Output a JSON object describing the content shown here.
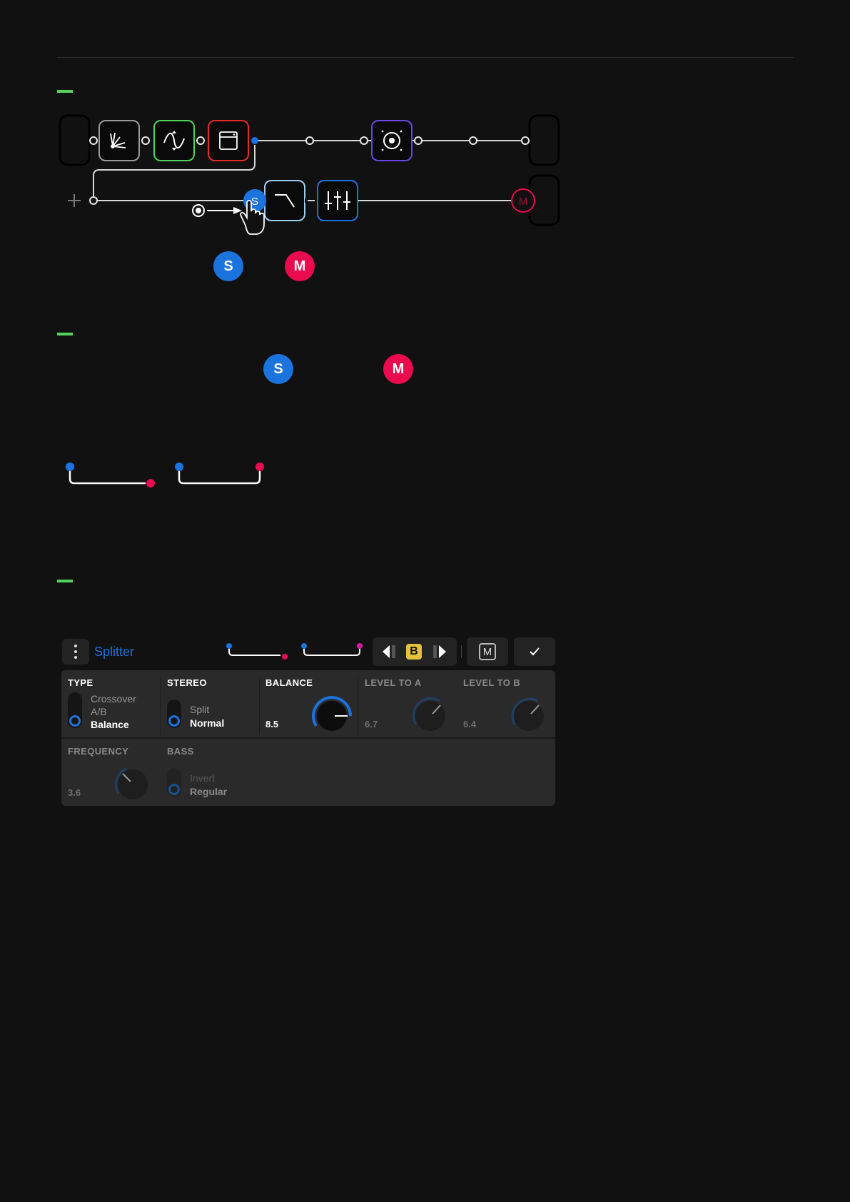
{
  "diagram": {
    "mixer_label": "M",
    "splitter_label": "S"
  },
  "section2": {
    "splitter_label": "S",
    "mixer_label": "M"
  },
  "legend_circles": {
    "splitter_label": "S",
    "mixer_label": "M"
  },
  "editor": {
    "title": "Splitter",
    "ab_label": "B",
    "mixer_button_label": "M",
    "params": {
      "type": {
        "label": "TYPE",
        "options": [
          "Crossover",
          "A/B",
          "Balance"
        ],
        "selected": "Balance"
      },
      "stereo": {
        "label": "STEREO",
        "options": [
          "Split",
          "Normal"
        ],
        "selected": "Normal"
      },
      "balance": {
        "label": "BALANCE",
        "value": "8.5"
      },
      "level_a": {
        "label": "LEVEL TO A",
        "value": "6.7"
      },
      "level_b": {
        "label": "LEVEL TO B",
        "value": "6.4"
      },
      "frequency": {
        "label": "FREQUENCY",
        "value": "3.6"
      },
      "bass": {
        "label": "BASS",
        "options": [
          "Invert",
          "Regular"
        ],
        "selected": "Regular"
      }
    }
  },
  "colors": {
    "background": "#111111",
    "accent_green": "#55d45b",
    "splitter_blue": "#1b73de",
    "mixer_red": "#ec0a4e",
    "yellow_b": "#e6c13a"
  }
}
